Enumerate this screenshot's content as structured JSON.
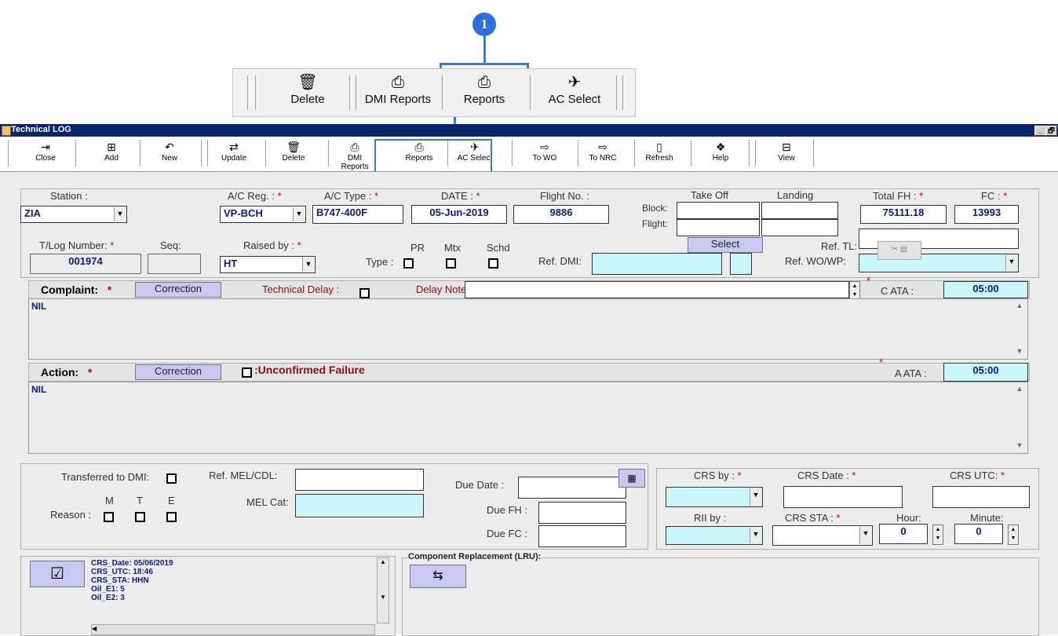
{
  "callout": {
    "number": "1"
  },
  "zoom_toolbar": {
    "delete": "Delete",
    "dmi_reports": "DMI Reports",
    "reports": "Reports",
    "ac_select": "AC Select"
  },
  "window": {
    "title": "Technical LOG",
    "min": "_",
    "max": "🗗"
  },
  "toolbar": {
    "close": "Close",
    "add": "Add",
    "new": "New",
    "update": "Update",
    "delete": "Delete",
    "dmi_reports": "DMI Reports",
    "reports": "Reports",
    "ac_select": "AC Select",
    "to_wo": "To WO",
    "to_nrc": "To NRC",
    "refresh": "Refresh",
    "help": "Help",
    "view": "View"
  },
  "header": {
    "station_label": "Station :",
    "station_value": "ZIA",
    "acreg_label": "A/C Reg. :",
    "acreg_value": "VP-BCH",
    "actype_label": "A/C Type :",
    "actype_value": "B747-400F",
    "date_label": "DATE :",
    "date_value": "05-Jun-2019",
    "flight_label": "Flight No. :",
    "flight_value": "9886",
    "takeoff_label": "Take Off",
    "landing_label": "Landing",
    "block_label": "Block:",
    "flight_row_label": "Flight:",
    "totalfh_label": "Total FH :",
    "totalfh_value": "75111.18",
    "fc_label": "FC :",
    "fc_value": "13993",
    "tlog_label": "T/Log Number:",
    "tlog_value": "001974",
    "seq_label": "Seq:",
    "raised_label": "Raised by :",
    "raised_value": "HT",
    "pr_label": "PR",
    "mtx_label": "Mtx",
    "schd_label": "Schd",
    "type_label": "Type :",
    "select_button": "Select",
    "refdmi_label": "Ref. DMI:",
    "reftl_label": "Ref. TL:",
    "refwo_label": "Ref. WO/WP:"
  },
  "complaint": {
    "label": "Complaint:",
    "correction": "Correction",
    "tech_delay": "Technical Delay :",
    "delay_note": "Delay Note :",
    "ata_label": "C  ATA :",
    "ata_value": "05:00",
    "text": "NIL"
  },
  "action": {
    "label": "Action:",
    "correction": "Correction",
    "unconfirmed": ":Unconfirmed Failure",
    "ata_label": "A  ATA :",
    "ata_value": "05:00",
    "text": "NIL"
  },
  "lower": {
    "transferred": "Transferred to DMI:",
    "m": "M",
    "t": "T",
    "e": "E",
    "reason": "Reason :",
    "refmel": "Ref. MEL/CDL:",
    "melcat": "MEL Cat:",
    "duedate": "Due Date :",
    "duefh": "Due FH :",
    "duefc": "Due FC :",
    "crsby": "CRS by :",
    "crsdate": "CRS Date :",
    "crsutc": "CRS UTC:",
    "riiby": "RII by :",
    "crssta": "CRS STA :",
    "hour": "Hour:",
    "minute": "Minute:",
    "hour_value": "0",
    "minute_value": "0"
  },
  "crs_info": {
    "lines": [
      "CRS_Date:  05/06/2019",
      "CRS_UTC:  18:46",
      "CRS_STA:  HHN",
      "Oil_E1:  5",
      "Oil_E2:  3"
    ]
  },
  "component": {
    "label": "Component Replacement (LRU):"
  }
}
